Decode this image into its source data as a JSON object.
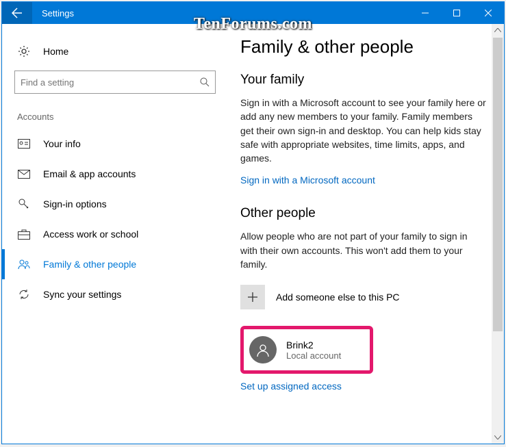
{
  "window": {
    "title": "Settings"
  },
  "watermark": "TenForums.com",
  "sidebar": {
    "home": "Home",
    "search_placeholder": "Find a setting",
    "group": "Accounts",
    "items": [
      {
        "label": "Your info"
      },
      {
        "label": "Email & app accounts"
      },
      {
        "label": "Sign-in options"
      },
      {
        "label": "Access work or school"
      },
      {
        "label": "Family & other people"
      },
      {
        "label": "Sync your settings"
      }
    ]
  },
  "content": {
    "title": "Family & other people",
    "family_heading": "Your family",
    "family_text": "Sign in with a Microsoft account to see your family here or add any new members to your family. Family members get their own sign-in and desktop. You can help kids stay safe with appropriate websites, time limits, apps, and games.",
    "signin_link": "Sign in with a Microsoft account",
    "other_heading": "Other people",
    "other_text": "Allow people who are not part of your family to sign in with their own accounts. This won't add them to your family.",
    "add_label": "Add someone else to this PC",
    "user": {
      "name": "Brink2",
      "type": "Local account"
    },
    "assigned_link": "Set up assigned access"
  }
}
